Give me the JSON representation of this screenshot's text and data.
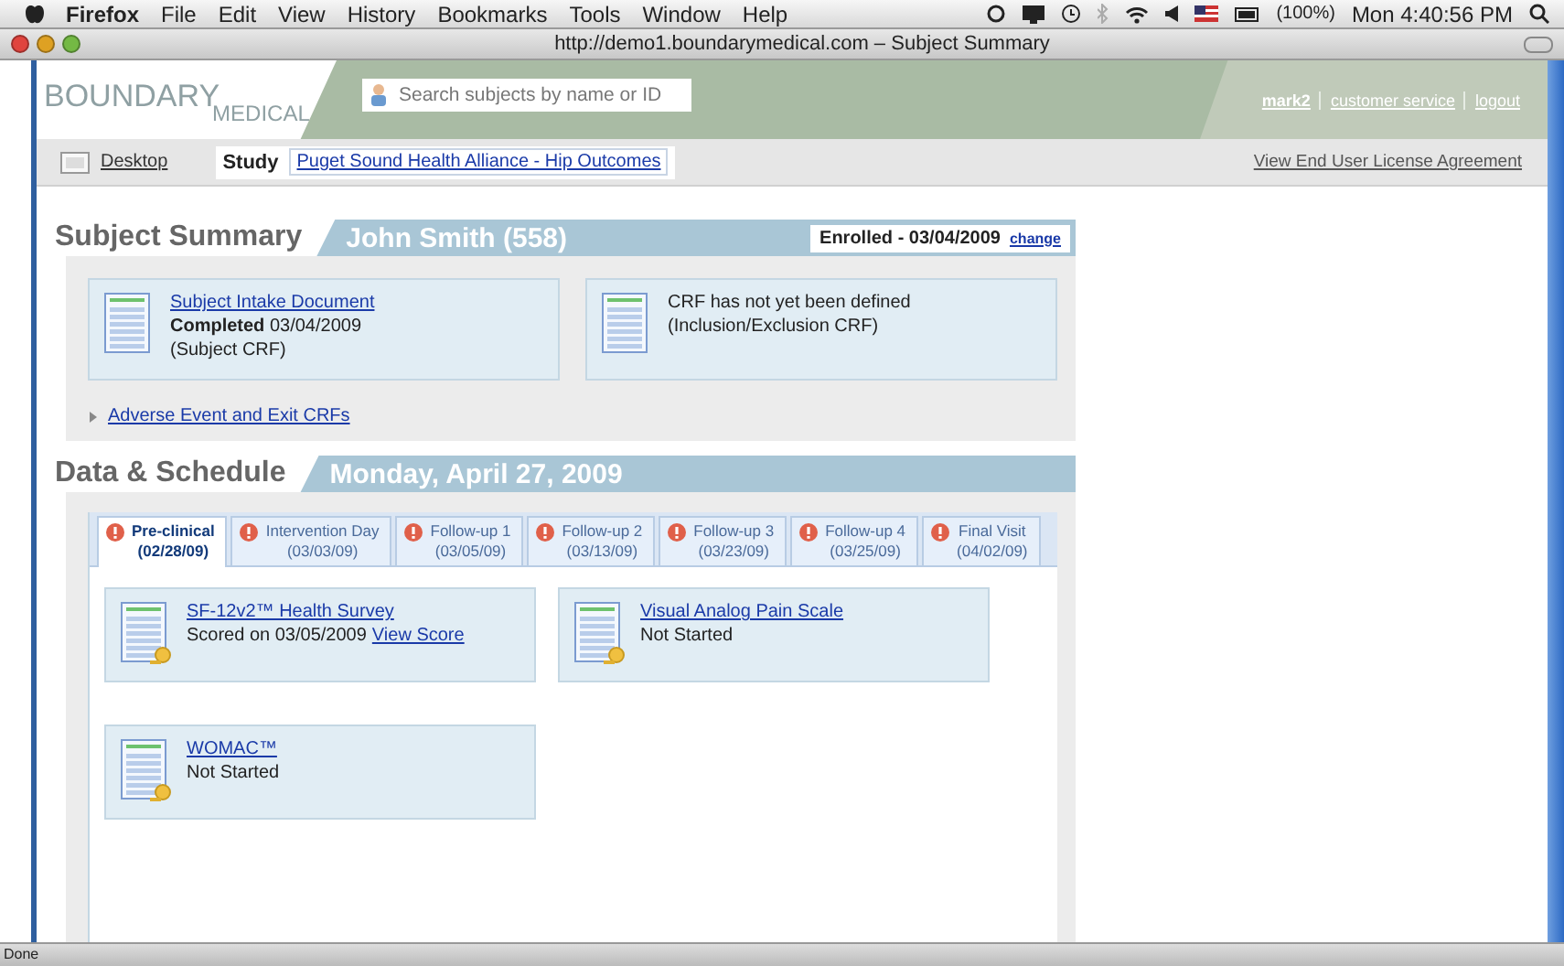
{
  "menubar": {
    "app": "Firefox",
    "menus": [
      "File",
      "Edit",
      "View",
      "History",
      "Bookmarks",
      "Tools",
      "Window",
      "Help"
    ],
    "battery": "(100%)",
    "clock": "Mon 4:40:56 PM"
  },
  "browser": {
    "title": "http://demo1.boundarymedical.com – Subject Summary"
  },
  "header": {
    "logo_primary": "BOUNDARY",
    "logo_secondary": "MEDICAL",
    "search": {
      "placeholder": "Search subjects by name or ID"
    },
    "links": [
      "mark2",
      "customer service",
      "logout"
    ]
  },
  "nav": {
    "desktop": "Desktop",
    "study_label": "Study",
    "study": "Puget Sound Health Alliance - Hip Outcomes",
    "eula": "View End User License Agreement"
  },
  "subject_summary": {
    "title": "Subject Summary",
    "subject": "John Smith (558)",
    "enrolled": "Enrolled - 03/04/2009",
    "change": "change",
    "documents": [
      {
        "link": "Subject Intake Document",
        "lines": [
          "**Completed** 03/04/2009",
          "(Subject CRF)"
        ]
      },
      {
        "lines": [
          "CRF has not yet been defined",
          "(Inclusion/Exclusion CRF)"
        ]
      }
    ],
    "expander": {
      "label": "Adverse Event and Exit CRFs",
      "expanded": false
    }
  },
  "schedule": {
    "title": "Data & Schedule",
    "date": "Monday, April 27, 2009",
    "tabs": [
      {
        "label": "Pre-clinical",
        "date": "(02/28/09)",
        "selected": true
      },
      {
        "label": "Intervention Day",
        "date": "(03/03/09)",
        "selected": false
      },
      {
        "label": "Follow-up 1",
        "date": "(03/05/09)",
        "selected": false
      },
      {
        "label": "Follow-up 2",
        "date": "(03/13/09)",
        "selected": false
      },
      {
        "label": "Follow-up 3",
        "date": "(03/23/09)",
        "selected": false
      },
      {
        "label": "Follow-up 4",
        "date": "(03/25/09)",
        "selected": false
      },
      {
        "label": "Final Visit",
        "date": "(04/02/09)",
        "selected": false
      }
    ],
    "forms": [
      {
        "title": "SF-12v2™ Health Survey",
        "status": "Scored on 03/05/2009",
        "action": "View Score"
      },
      {
        "title": "Visual Analog Pain Scale",
        "status": "Not Started"
      },
      {
        "title": "WOMAC™",
        "status": "Not Started"
      }
    ]
  },
  "status_bar": "Done"
}
